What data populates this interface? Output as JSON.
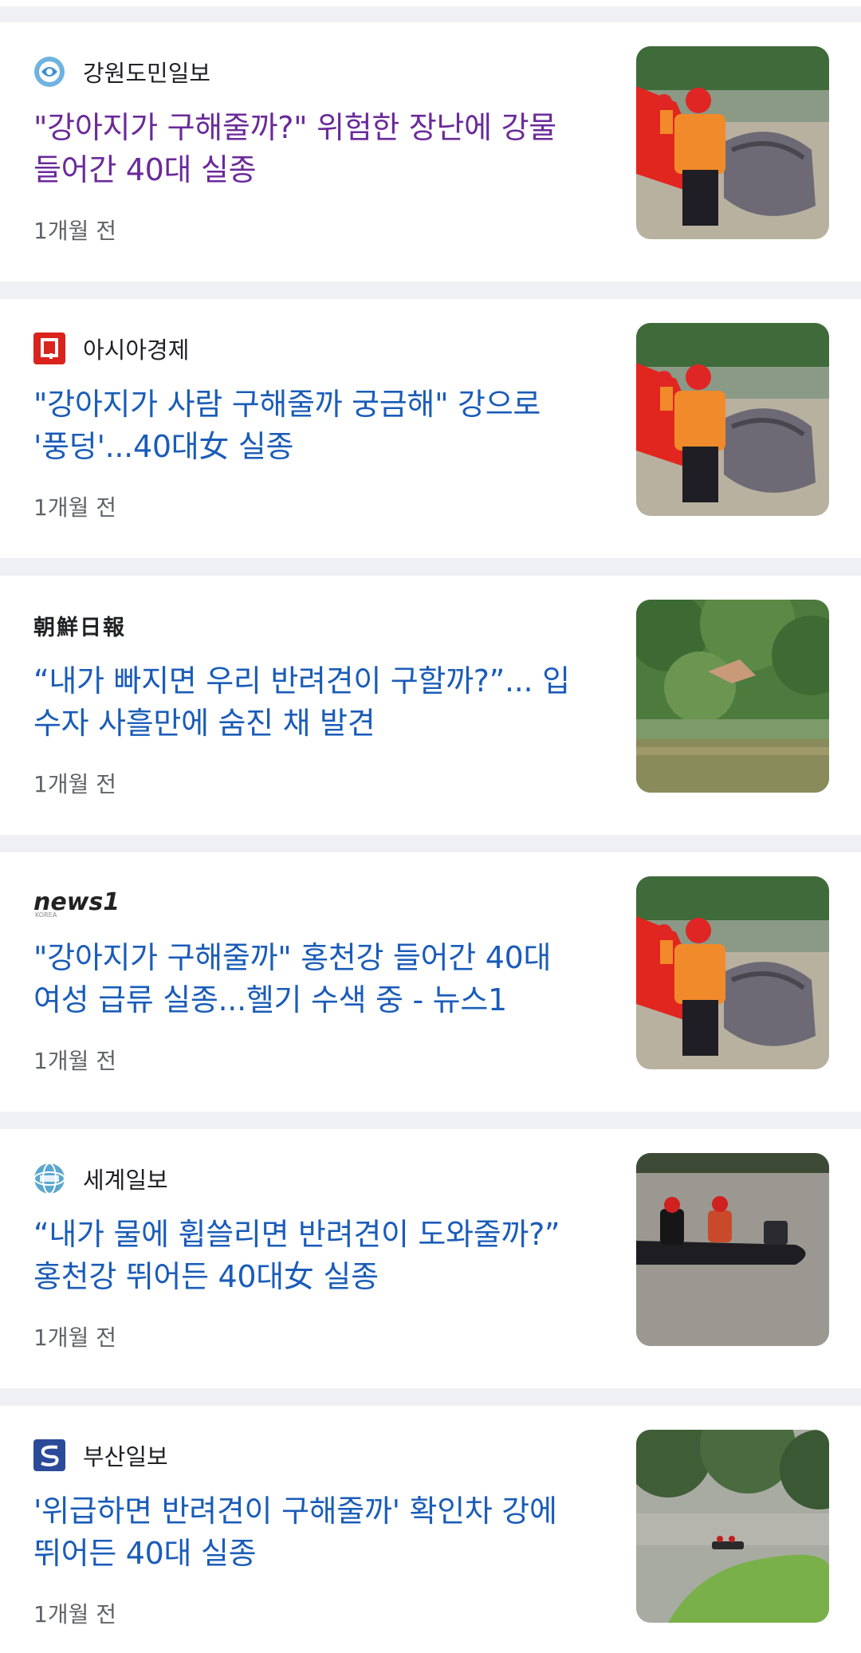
{
  "articles": [
    {
      "source": "강원도민일보",
      "headline_line1": "\"강아지가 구해줄까?\" 위험한 장난에 강물",
      "headline_line2": "들어간 40대 실종",
      "time": "1개월 전",
      "logo_icon": "kangwon-dominilbo-logo-icon",
      "thumb": "rescue-boat-photo"
    },
    {
      "source": "아시아경제",
      "headline_line1": "\"강아지가 사람 구해줄까 궁금해\" 강으로",
      "headline_line2": "'풍덩'...40대女 실종",
      "time": "1개월 전",
      "logo_icon": "asiae-logo-icon",
      "thumb": "rescue-boat-photo"
    },
    {
      "source": "朝鮮日報",
      "headline_line1": "“내가 빠지면 우리 반려견이 구할까?”... 입",
      "headline_line2": "수자 사흘만에 숨진 채 발견",
      "time": "1개월 전",
      "logo_icon": "chosun-logo",
      "thumb": "riverbank-photo"
    },
    {
      "source": "news1",
      "source_sub": "KOREA",
      "headline_line1": "\"강아지가 구해줄까\" 홍천강 들어간 40대",
      "headline_line2": "여성 급류 실종...헬기 수색 중 - 뉴스1",
      "time": "1개월 전",
      "logo_icon": "news1-logo",
      "thumb": "rescue-boat-photo"
    },
    {
      "source": "세계일보",
      "headline_line1": "“내가 물에 휩쓸리면 반려견이 도와줄까?”",
      "headline_line2": "홍천강 뛰어든 40대女 실종",
      "time": "1개월 전",
      "logo_icon": "segye-logo-icon",
      "thumb": "river-rescue-photo"
    },
    {
      "source": "부산일보",
      "headline_line1": "'위급하면 반려견이 구해줄까' 확인차 강에",
      "headline_line2": "뛰어든 40대 실종",
      "time": "1개월 전",
      "logo_icon": "busan-ilbo-logo-icon",
      "thumb": "distant-boat-photo"
    }
  ],
  "colors": {
    "headline": "#1a5cb8",
    "headline_visited": "#6a2a9a",
    "meta": "#5f6368",
    "divider": "#eef0f3"
  }
}
